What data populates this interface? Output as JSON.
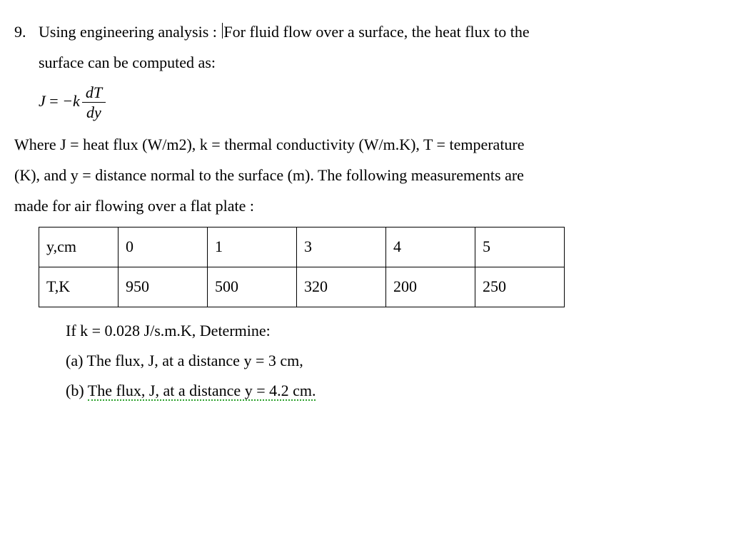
{
  "problem_number": "9.",
  "intro_before_cursor": "Using engineering analysis : ",
  "intro_after_cursor": "For fluid flow over a surface, the heat flux to the",
  "intro_line2": "surface can be computed as:",
  "equation": {
    "lhs": "J",
    "eq": " = ",
    "minus_k": "−k",
    "frac_top": "dT",
    "frac_bot": "dy"
  },
  "definitions_line1": "Where J = heat flux (W/m2), k = thermal conductivity (W/m.K), T = temperature",
  "definitions_line2": "(K), and y = distance normal to the surface (m). The following measurements are",
  "definitions_line3": "made for air flowing over a flat plate :",
  "table": {
    "row1": [
      "y,cm",
      "0",
      "1",
      "3",
      "4",
      "5"
    ],
    "row2": [
      "T,K",
      "950",
      "500",
      "320",
      "200",
      "250"
    ]
  },
  "k_line": "If k = 0.028 J/s.m.K, Determine:",
  "part_a": "(a)  The flux, J, at a distance y = 3 cm,",
  "part_b_label": "(b)  ",
  "part_b_text": "The flux, J, at a distance y = 4.2 cm."
}
